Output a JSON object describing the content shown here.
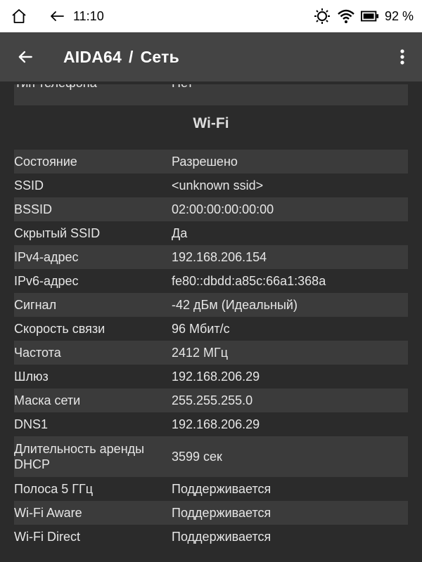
{
  "status_bar": {
    "time": "11:10",
    "battery": "92 %"
  },
  "app_bar": {
    "app_name": "AIDA64",
    "separator": "/",
    "page_name": "Сеть"
  },
  "partial_row": {
    "key": "Тип телефона",
    "value": "Нет"
  },
  "section": {
    "title": "Wi-Fi"
  },
  "rows": [
    {
      "key": "Состояние",
      "value": "Разрешено"
    },
    {
      "key": "SSID",
      "value": "<unknown ssid>"
    },
    {
      "key": "BSSID",
      "value": "02:00:00:00:00:00"
    },
    {
      "key": "Скрытый SSID",
      "value": "Да"
    },
    {
      "key": "IPv4-адрес",
      "value": "192.168.206.154"
    },
    {
      "key": "IPv6-адрес",
      "value": "fe80::dbdd:a85c:66a1:368a"
    },
    {
      "key": "Сигнал",
      "value": "-42 дБм (Идеальный)"
    },
    {
      "key": "Скорость связи",
      "value": "96 Мбит/с"
    },
    {
      "key": "Частота",
      "value": "2412 МГц"
    },
    {
      "key": "Шлюз",
      "value": "192.168.206.29"
    },
    {
      "key": "Маска сети",
      "value": "255.255.255.0"
    },
    {
      "key": "DNS1",
      "value": "192.168.206.29"
    },
    {
      "key": "Длительность аренды DHCP",
      "value": "3599 сек"
    },
    {
      "key": "Полоса 5 ГГц",
      "value": "Поддерживается"
    },
    {
      "key": "Wi-Fi Aware",
      "value": "Поддерживается"
    },
    {
      "key": "Wi-Fi Direct",
      "value": "Поддерживается"
    }
  ]
}
